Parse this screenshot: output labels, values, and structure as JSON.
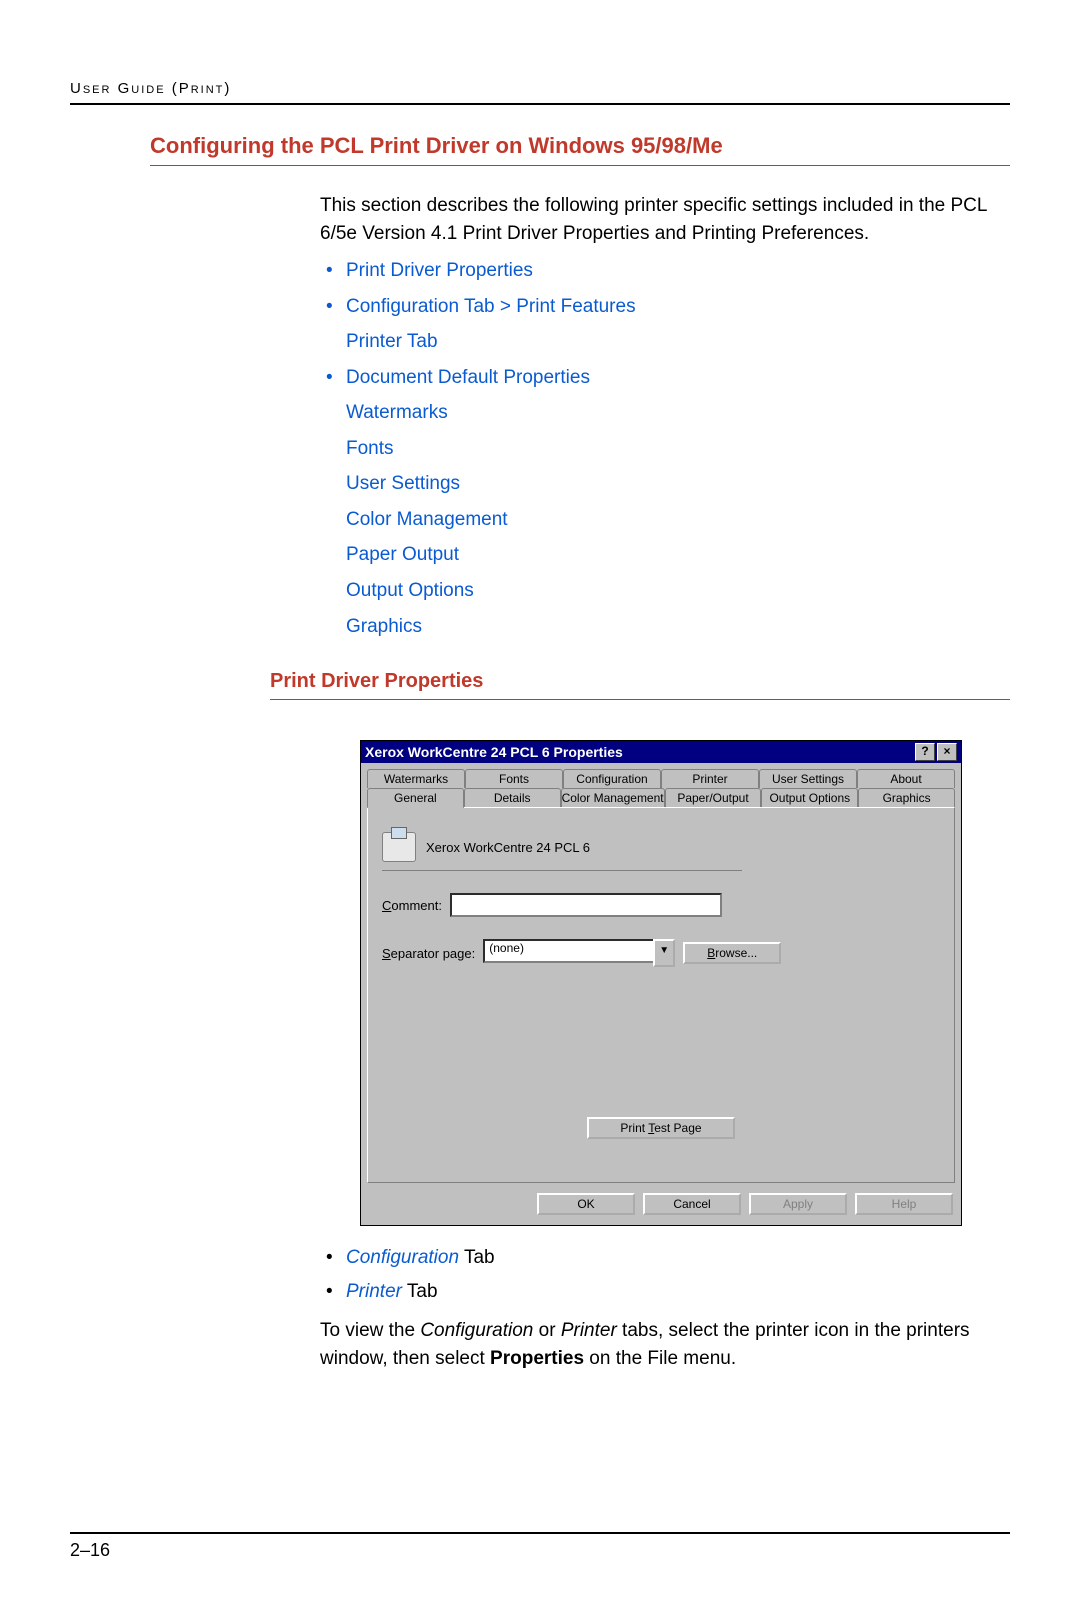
{
  "header": {
    "breadcrumb": "User Guide (Print)"
  },
  "section": {
    "title": "Configuring the PCL Print Driver on Windows 95/98/Me",
    "intro": "This section describes the following printer specific settings included in the PCL 6/5e Version 4.1 Print Driver Properties and Printing Preferences.",
    "links": {
      "l1": "Print Driver Properties",
      "l2": "Configuration Tab > Print Features",
      "l2a": "Printer Tab",
      "l3": "Document Default Properties",
      "l3a": "Watermarks",
      "l3b": "Fonts",
      "l3c": "User Settings",
      "l3d": "Color Management",
      "l3e": "Paper Output",
      "l3f": "Output Options",
      "l3g": "Graphics"
    }
  },
  "subheading": "Print Driver Properties",
  "dialog": {
    "title": "Xerox WorkCentre 24  PCL 6 Properties",
    "help_btn": "?",
    "close_btn": "×",
    "tabs_row1": {
      "t0": "Watermarks",
      "t1": "Fonts",
      "t2": "Configuration",
      "t3": "Printer",
      "t4": "User Settings",
      "t5": "About"
    },
    "tabs_row2": {
      "t0": "General",
      "t1": "Details",
      "t2": "Color Management",
      "t3": "Paper/Output",
      "t4": "Output Options",
      "t5": "Graphics"
    },
    "printer_name": "Xerox WorkCentre 24 PCL 6",
    "comment_label_pre": "C",
    "comment_label_post": "omment:",
    "comment_value": "",
    "sep_label_pre": "S",
    "sep_label_post": "eparator page:",
    "sep_value": "(none)",
    "browse_pre": "B",
    "browse_post": "rowse...",
    "test_pre": "Print ",
    "test_u": "T",
    "test_post": "est Page",
    "ok": "OK",
    "cancel": "Cancel",
    "apply": "Apply",
    "help": "Help"
  },
  "below": {
    "b1_link": "Configuration",
    "b1_suffix": " Tab",
    "b2_link": "Printer",
    "b2_suffix": " Tab",
    "para_a": "To view the ",
    "para_i1": "Configuration",
    "para_b": " or ",
    "para_i2": "Printer",
    "para_c": " tabs, select the printer icon in the printers window, then select ",
    "para_bold": "Properties",
    "para_d": " on the File menu."
  },
  "footer": {
    "page": "2–16"
  }
}
